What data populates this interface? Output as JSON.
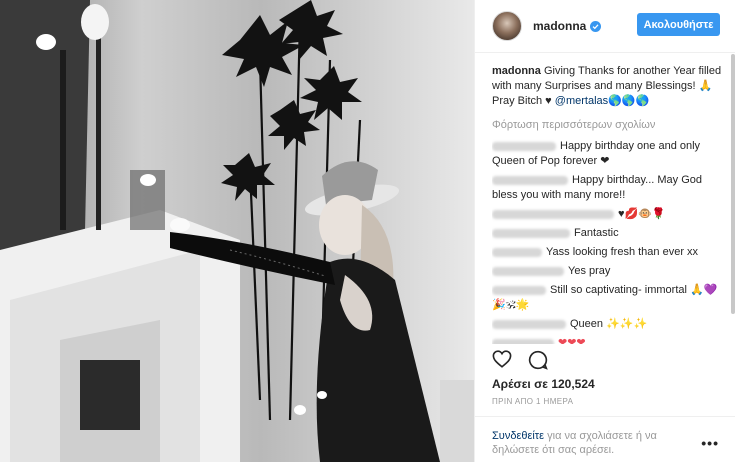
{
  "header": {
    "username": "madonna",
    "verified_icon": "verified-badge-icon",
    "follow_label": "Ακολουθήστε"
  },
  "caption": {
    "user": "madonna",
    "text": "Giving Thanks for another Year filled with many Surprises and many Blessings! 🙏 Pray Bitch ♥",
    "mention": "@mertalas🌎🌎🌎"
  },
  "load_more": "Φόρτωση περισσότερων σχολίων",
  "comments": [
    {
      "text": "Happy birthday one and only Queen of Pop forever ❤"
    },
    {
      "text": "Happy birthday... May God bless you with many more!!"
    },
    {
      "text": "♥💋🐵🌹"
    },
    {
      "text": "Fantastic"
    },
    {
      "text": "Yass looking fresh than ever xx"
    },
    {
      "text": "Yes pray"
    },
    {
      "text": "Still so captivating- immortal 🙏💜🎉🕉🌟"
    },
    {
      "text": "Queen ✨✨✨"
    },
    {
      "text": "❤❤❤"
    }
  ],
  "likes": "Αρέσει σε 120,524",
  "time": "ΠΡΙΝ ΑΠΟ 1 ΗΜΕΡΑ",
  "footer": {
    "login_link": "Συνδεθείτε",
    "login_text": " για να σχολιάσετε ή να δηλώσετε ότι σας αρέσει.",
    "more": "•••"
  },
  "colors": {
    "accent": "#3897f0",
    "link": "#003569",
    "heart": "#ed4956",
    "muted": "#999999"
  },
  "icons": [
    "heart-outline-icon",
    "comment-bubble-icon",
    "verified-badge-icon",
    "more-options-icon"
  ]
}
